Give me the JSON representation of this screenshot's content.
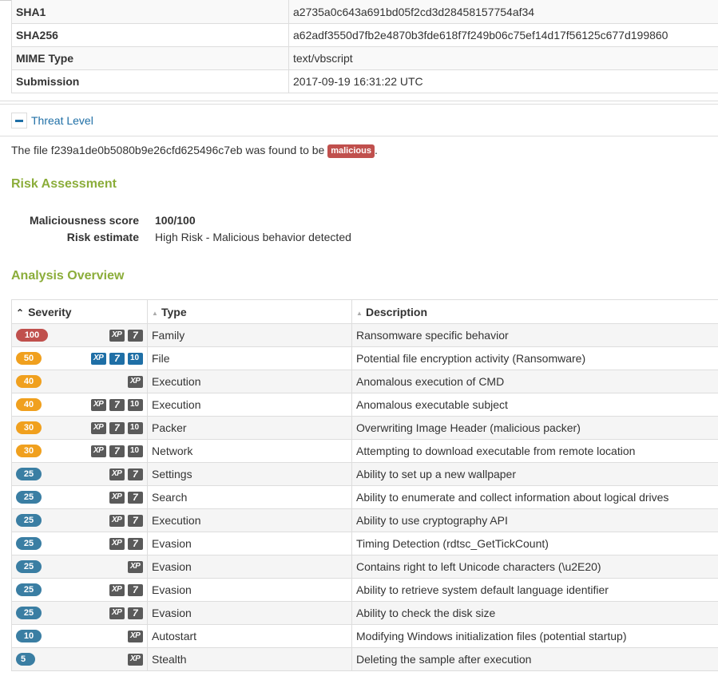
{
  "file_info": [
    {
      "key": "SHA1",
      "value": "a2735a0c643a691bd05f2cd3d28458157754af34"
    },
    {
      "key": "SHA256",
      "value": "a62adf3550d7fb2e4870b3fde618f7f249b06c75ef14d17f56125c677d199860"
    },
    {
      "key": "MIME Type",
      "value": "text/vbscript"
    },
    {
      "key": "Submission",
      "value": "2017-09-19 16:31:22 UTC"
    }
  ],
  "threat_level": {
    "toggle_label": "Threat Level",
    "verdict_prefix": "The file f239a1de0b5080b9e26cfd625496c7eb was found to be",
    "verdict_badge": "malicious",
    "verdict_suffix": "."
  },
  "risk_assessment": {
    "heading": "Risk Assessment",
    "rows": [
      {
        "label": "Maliciousness score",
        "value": "100/100"
      },
      {
        "label": "Risk estimate",
        "value": "High Risk - Malicious behavior detected"
      }
    ]
  },
  "analysis_overview": {
    "heading": "Analysis Overview",
    "columns": [
      "Severity",
      "Type",
      "Description"
    ],
    "colors": {
      "red": "#c0504d",
      "orange": "#f0a01e",
      "blue": "#3a7ea3"
    },
    "rows": [
      {
        "score": "100",
        "color": "red",
        "os": [
          "xp",
          "w7"
        ],
        "type": "Family",
        "description": "Ransomware specific behavior"
      },
      {
        "score": "50",
        "color": "orange",
        "os": [
          "xp-blue",
          "w7-blue",
          "w10-blue"
        ],
        "type": "File",
        "description": "Potential file encryption activity (Ransomware)"
      },
      {
        "score": "40",
        "color": "orange",
        "os": [
          "xp"
        ],
        "type": "Execution",
        "description": "Anomalous execution of CMD"
      },
      {
        "score": "40",
        "color": "orange",
        "os": [
          "xp",
          "w7",
          "w10"
        ],
        "type": "Execution",
        "description": "Anomalous executable subject"
      },
      {
        "score": "30",
        "color": "orange",
        "os": [
          "xp",
          "w7",
          "w10"
        ],
        "type": "Packer",
        "description": "Overwriting Image Header (malicious packer)"
      },
      {
        "score": "30",
        "color": "orange",
        "os": [
          "xp",
          "w7",
          "w10"
        ],
        "type": "Network",
        "description": "Attempting to download executable from remote location"
      },
      {
        "score": "25",
        "color": "blue",
        "os": [
          "xp",
          "w7"
        ],
        "type": "Settings",
        "description": "Ability to set up a new wallpaper"
      },
      {
        "score": "25",
        "color": "blue",
        "os": [
          "xp",
          "w7"
        ],
        "type": "Search",
        "description": "Ability to enumerate and collect information about logical drives"
      },
      {
        "score": "25",
        "color": "blue",
        "os": [
          "xp",
          "w7"
        ],
        "type": "Execution",
        "description": "Ability to use cryptography API"
      },
      {
        "score": "25",
        "color": "blue",
        "os": [
          "xp",
          "w7"
        ],
        "type": "Evasion",
        "description": "Timing Detection (rdtsc_GetTickCount)"
      },
      {
        "score": "25",
        "color": "blue",
        "os": [
          "xp"
        ],
        "type": "Evasion",
        "description": "Contains right to left Unicode characters (\\u2E20)"
      },
      {
        "score": "25",
        "color": "blue",
        "os": [
          "xp",
          "w7"
        ],
        "type": "Evasion",
        "description": "Ability to retrieve system default language identifier"
      },
      {
        "score": "25",
        "color": "blue",
        "os": [
          "xp",
          "w7"
        ],
        "type": "Evasion",
        "description": "Ability to check the disk size"
      },
      {
        "score": "10",
        "color": "blue",
        "os": [
          "xp"
        ],
        "type": "Autostart",
        "description": "Modifying Windows initialization files (potential startup)"
      },
      {
        "score": "5",
        "color": "blue",
        "os": [
          "xp"
        ],
        "type": "Stealth",
        "description": "Deleting the sample after execution"
      }
    ]
  }
}
